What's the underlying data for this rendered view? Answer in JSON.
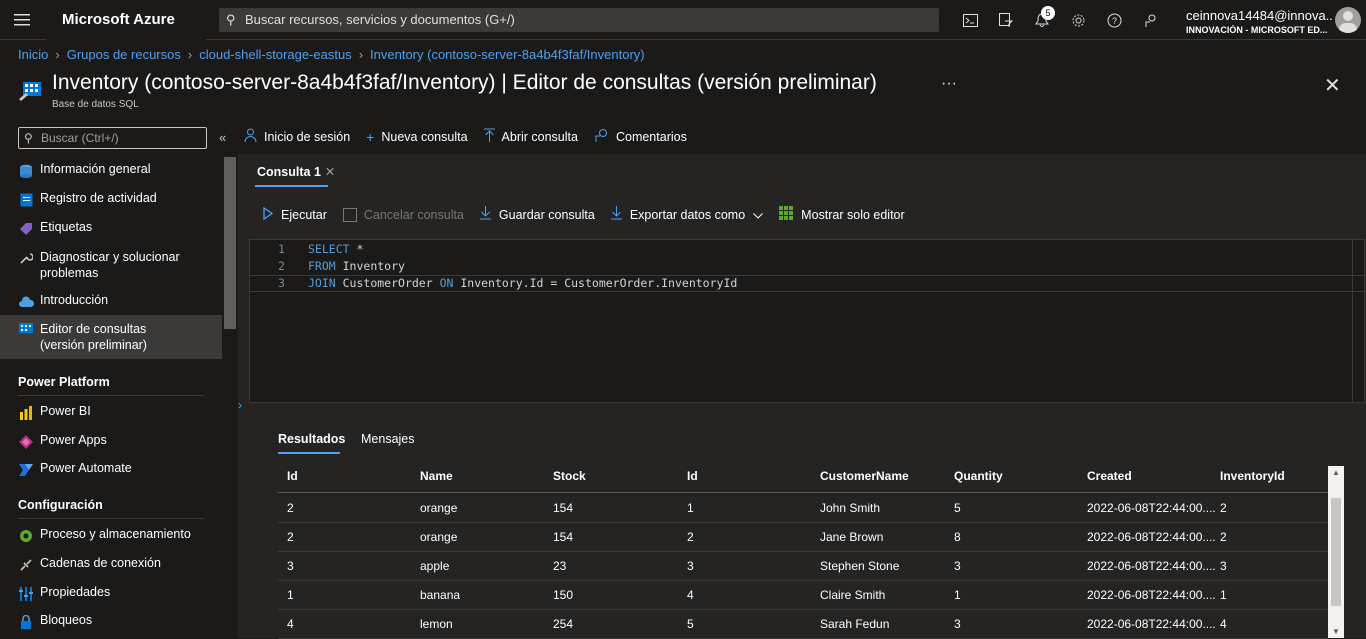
{
  "header": {
    "brand": "Microsoft Azure",
    "search_placeholder": "Buscar recursos, servicios y documentos (G+/)",
    "notification_count": "5",
    "user_name": "ceinnova14484@innova...",
    "user_org": "INNOVACIÓN - MICROSOFT ED..."
  },
  "breadcrumb": [
    "Inicio",
    "Grupos de recursos",
    "cloud-shell-storage-eastus",
    "Inventory (contoso-server-8a4b4f3faf/Inventory)"
  ],
  "page": {
    "title_main": "Inventory (contoso-server-8a4b4f3faf/Inventory)",
    "title_rest": " | Editor de consultas (versión preliminar)",
    "subtitle": "Base de datos SQL",
    "more": "···"
  },
  "sidebar": {
    "search_placeholder": "Buscar (Ctrl+/)",
    "collapse": "«",
    "items": [
      {
        "label": "Información general"
      },
      {
        "label": "Registro de actividad"
      },
      {
        "label": "Etiquetas"
      },
      {
        "label": "Diagnosticar y solucionar problemas"
      },
      {
        "label": "Introducción"
      },
      {
        "label": "Editor de consultas (versión preliminar)"
      }
    ],
    "section_power": "Power Platform",
    "power_items": [
      {
        "label": "Power BI"
      },
      {
        "label": "Power Apps"
      },
      {
        "label": "Power Automate"
      }
    ],
    "section_config": "Configuración",
    "config_items": [
      {
        "label": "Proceso y almacenamiento"
      },
      {
        "label": "Cadenas de conexión"
      },
      {
        "label": "Propiedades"
      },
      {
        "label": "Bloqueos"
      }
    ]
  },
  "commandbar": {
    "login": "Inicio de sesión",
    "new_query": "Nueva consulta",
    "open_query": "Abrir consulta",
    "feedback": "Comentarios"
  },
  "editor": {
    "tab": "Consulta 1",
    "run": "Ejecutar",
    "cancel": "Cancelar consulta",
    "save": "Guardar consulta",
    "export": "Exportar datos como",
    "show_editor": "Mostrar solo editor",
    "lines": [
      {
        "n": "1"
      },
      {
        "n": "2"
      },
      {
        "n": "3"
      }
    ]
  },
  "results": {
    "tab_results": "Resultados",
    "tab_messages": "Mensajes",
    "columns": [
      "Id",
      "Name",
      "Stock",
      "Id",
      "CustomerName",
      "Quantity",
      "Created",
      "InventoryId"
    ],
    "rows": [
      [
        "2",
        "orange",
        "154",
        "1",
        "John Smith",
        "5",
        "2022-06-08T22:44:00....",
        "2"
      ],
      [
        "2",
        "orange",
        "154",
        "2",
        "Jane Brown",
        "8",
        "2022-06-08T22:44:00....",
        "2"
      ],
      [
        "3",
        "apple",
        "23",
        "3",
        "Stephen Stone",
        "3",
        "2022-06-08T22:44:00....",
        "3"
      ],
      [
        "1",
        "banana",
        "150",
        "4",
        "Claire Smith",
        "1",
        "2022-06-08T22:44:00....",
        "1"
      ],
      [
        "4",
        "lemon",
        "254",
        "5",
        "Sarah Fedun",
        "3",
        "2022-06-08T22:44:00....",
        "4"
      ]
    ]
  },
  "colors": {
    "accent": "#4fa0f0",
    "background": "#1b1a19",
    "panel": "#252423"
  }
}
